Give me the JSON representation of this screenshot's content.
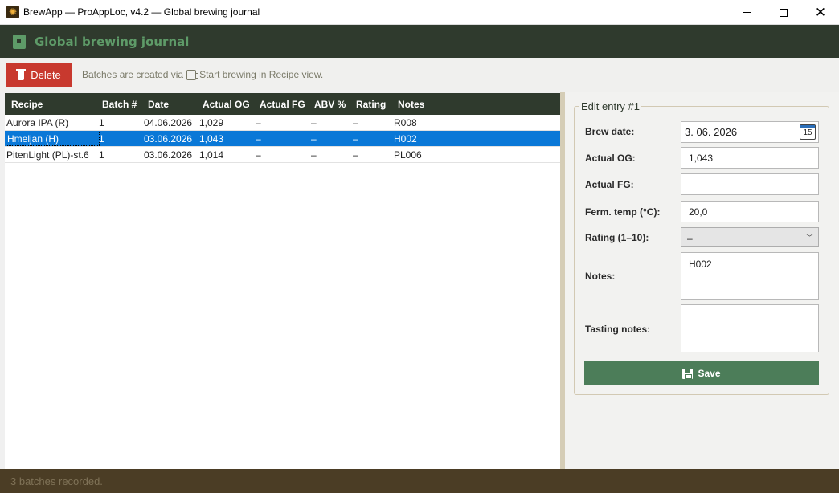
{
  "window": {
    "title": "BrewApp — ProAppLoc, v4.2 — Global brewing journal",
    "minimize_glyph": "",
    "maximize_glyph": "",
    "close_glyph": "✕"
  },
  "header": {
    "title": "Global brewing journal",
    "icon": "journal-book-icon"
  },
  "toolbar": {
    "delete_label": "Delete",
    "hint_before": "Batches are created via",
    "hint_after": "Start brewing in Recipe view."
  },
  "grid": {
    "columns": [
      "Recipe",
      "Batch #",
      "Date",
      "Actual OG",
      "Actual FG",
      "ABV %",
      "Rating",
      "Notes"
    ],
    "rows": [
      {
        "recipe": "Aurora IPA (R)",
        "batch": "1",
        "date": "04.06.2026",
        "og": "1,029",
        "fg": "–",
        "abv": "–",
        "rating": "–",
        "notes": "R008"
      },
      {
        "recipe": "Hmeljan (H)",
        "batch": "1",
        "date": "03.06.2026",
        "og": "1,043",
        "fg": "–",
        "abv": "–",
        "rating": "–",
        "notes": "H002"
      },
      {
        "recipe": "PitenLight (PL)-st.6",
        "batch": "1",
        "date": "03.06.2026",
        "og": "1,014",
        "fg": "–",
        "abv": "–",
        "rating": "–",
        "notes": "PL006"
      }
    ],
    "selected_index": 1
  },
  "edit": {
    "legend": "Edit entry  #1",
    "brew_date_label": "Brew date:",
    "brew_date_value": "3. 06. 2026",
    "calendar_day": "15",
    "og_label": "Actual OG:",
    "og_value": "1,043",
    "fg_label": "Actual FG:",
    "fg_value": "",
    "temp_label": "Ferm. temp (°C):",
    "temp_value": "20,0",
    "rating_label": "Rating (1–10):",
    "rating_value": "–",
    "notes_label": "Notes:",
    "notes_value": "H002",
    "tasting_label": "Tasting notes:",
    "tasting_value": "",
    "save_label": "Save"
  },
  "status": {
    "text": "3 batches recorded."
  }
}
